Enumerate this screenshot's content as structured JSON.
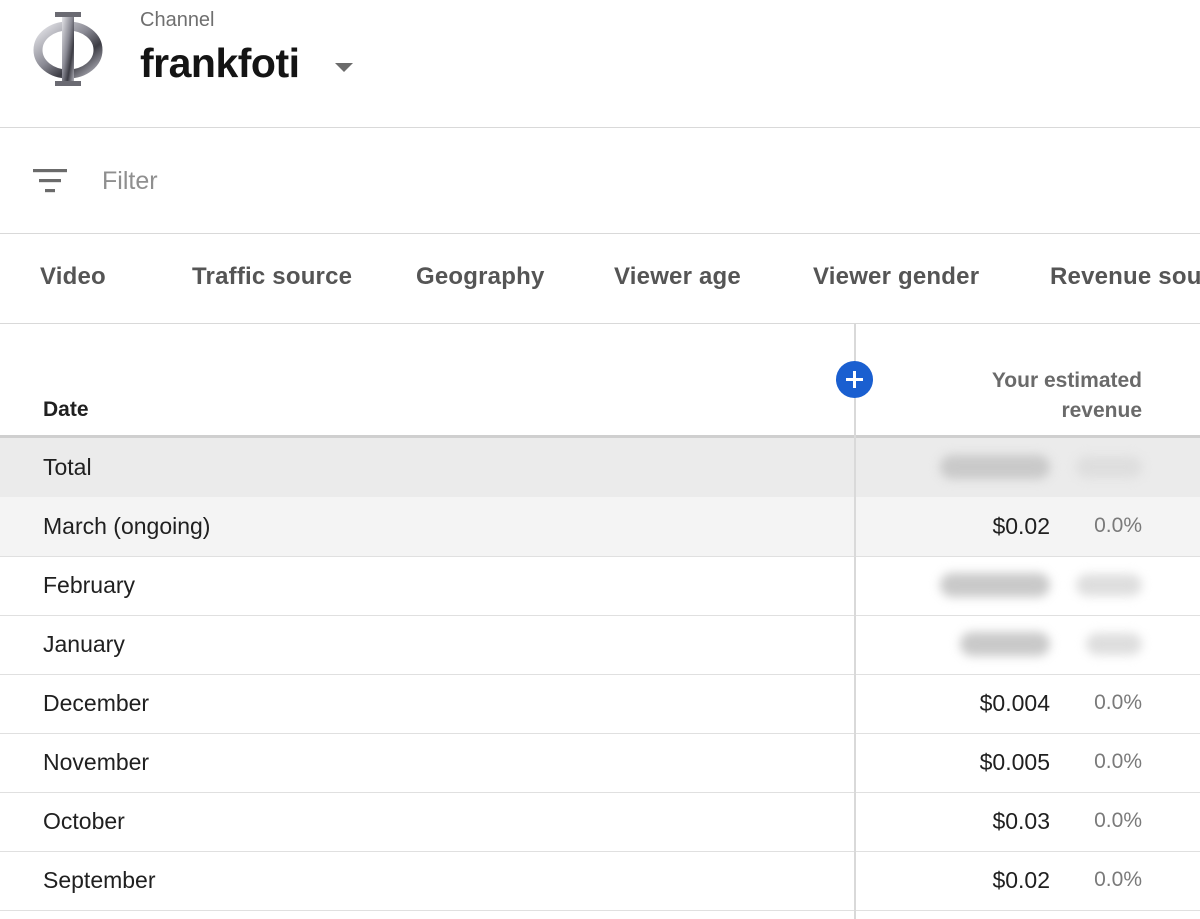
{
  "header": {
    "channel_label": "Channel",
    "channel_name": "frankfoti",
    "logo_icon": "phi-logo-icon",
    "dropdown_icon": "caret-down-icon"
  },
  "filter": {
    "icon": "filter-icon",
    "placeholder": "Filter"
  },
  "tabs": [
    {
      "label": "Video"
    },
    {
      "label": "Traffic source"
    },
    {
      "label": "Geography"
    },
    {
      "label": "Viewer age"
    },
    {
      "label": "Viewer gender"
    },
    {
      "label": "Revenue sour"
    }
  ],
  "table": {
    "date_header": "Date",
    "revenue_header_line1": "Your estimated",
    "revenue_header_line2": "revenue",
    "add_icon": "plus-circle-icon",
    "rows": [
      {
        "date": "Total",
        "value": null,
        "pct": null
      },
      {
        "date": "March (ongoing)",
        "value": "$0.02",
        "pct": "0.0%"
      },
      {
        "date": "February",
        "value": null,
        "pct": null
      },
      {
        "date": "January",
        "value": null,
        "pct": null
      },
      {
        "date": "December",
        "value": "$0.004",
        "pct": "0.0%"
      },
      {
        "date": "November",
        "value": "$0.005",
        "pct": "0.0%"
      },
      {
        "date": "October",
        "value": "$0.03",
        "pct": "0.0%"
      },
      {
        "date": "September",
        "value": "$0.02",
        "pct": "0.0%"
      }
    ]
  },
  "colors": {
    "accent": "#1a5fd0",
    "divider": "#d9d9d9",
    "total_row_bg": "#ebebeb"
  }
}
